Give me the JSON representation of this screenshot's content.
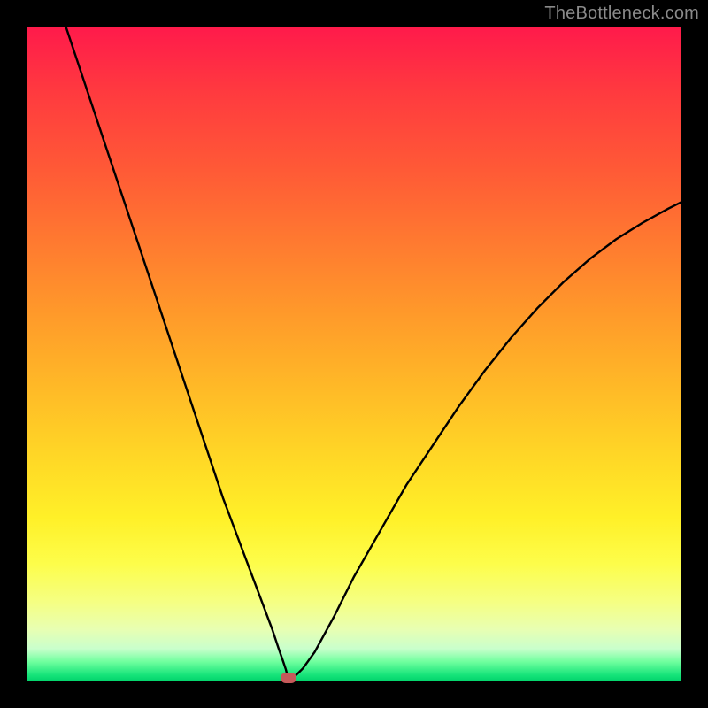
{
  "watermark": "TheBottleneck.com",
  "chart_data": {
    "type": "line",
    "title": "",
    "xlabel": "",
    "ylabel": "",
    "xlim": [
      0,
      100
    ],
    "ylim": [
      0,
      100
    ],
    "grid": false,
    "legend": false,
    "background_gradient": {
      "top_color": "#ff1a4b",
      "bottom_color": "#00d26a"
    },
    "series": [
      {
        "name": "bottleneck-curve",
        "color": "#000000",
        "x": [
          6,
          9,
          12,
          15,
          18,
          21,
          24,
          27,
          30,
          33,
          36,
          37.5,
          38.5,
          39.2,
          39.6,
          39.8,
          40,
          40.5,
          41.2,
          42.2,
          44,
          47,
          50,
          54,
          58,
          62,
          66,
          70,
          74,
          78,
          82,
          86,
          90,
          94,
          98,
          100
        ],
        "y": [
          100,
          91,
          82,
          73,
          64,
          55,
          46,
          37,
          28,
          20,
          12,
          8,
          5,
          3,
          1.8,
          1.0,
          0.6,
          0.6,
          1.0,
          2.0,
          4.5,
          10,
          16,
          23,
          30,
          36,
          42,
          47.5,
          52.5,
          57,
          61,
          64.5,
          67.5,
          70,
          72.2,
          73.2
        ]
      }
    ],
    "marker": {
      "name": "optimal-point",
      "x": 40,
      "y": 0.6,
      "color": "#c65a5a"
    }
  }
}
